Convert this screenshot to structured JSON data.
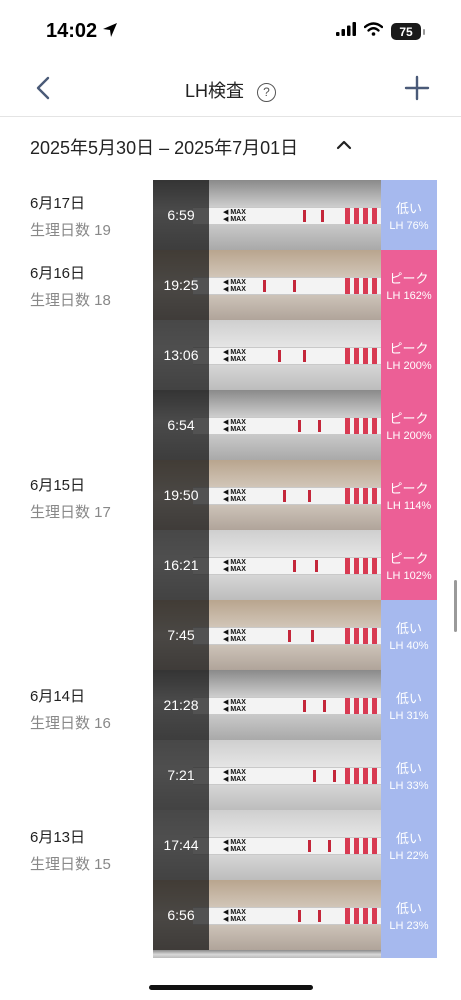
{
  "status_bar": {
    "time": "14:02",
    "battery": "75"
  },
  "nav": {
    "title": "LH検査",
    "help_icon": "?"
  },
  "range": {
    "label": "2025年5月30日 – 2025年7月01日"
  },
  "days": [
    {
      "date": "6月17日",
      "cycle": "生理日数 19"
    },
    {
      "date": "6月16日",
      "cycle": "生理日数 18"
    },
    {
      "date": "6月15日",
      "cycle": "生理日数 17"
    },
    {
      "date": "6月14日",
      "cycle": "生理日数 16"
    },
    {
      "date": "6月13日",
      "cycle": "生理日数 15"
    }
  ],
  "entries": [
    {
      "time": "6:59",
      "status": "低い",
      "lh": "LH 76%",
      "level": "low",
      "lh_percent": 76
    },
    {
      "time": "19:25",
      "status": "ピーク",
      "lh": "LH 162%",
      "level": "peak",
      "lh_percent": 162
    },
    {
      "time": "13:06",
      "status": "ピーク",
      "lh": "LH 200%",
      "level": "peak",
      "lh_percent": 200
    },
    {
      "time": "6:54",
      "status": "ピーク",
      "lh": "LH 200%",
      "level": "peak",
      "lh_percent": 200
    },
    {
      "time": "19:50",
      "status": "ピーク",
      "lh": "LH 114%",
      "level": "peak",
      "lh_percent": 114
    },
    {
      "time": "16:21",
      "status": "ピーク",
      "lh": "LH 102%",
      "level": "peak",
      "lh_percent": 102
    },
    {
      "time": "7:45",
      "status": "低い",
      "lh": "LH 40%",
      "level": "low",
      "lh_percent": 40
    },
    {
      "time": "21:28",
      "status": "低い",
      "lh": "LH 31%",
      "level": "low",
      "lh_percent": 31
    },
    {
      "time": "7:21",
      "status": "低い",
      "lh": "LH 33%",
      "level": "low",
      "lh_percent": 33
    },
    {
      "time": "17:44",
      "status": "低い",
      "lh": "LH 22%",
      "level": "low",
      "lh_percent": 22
    },
    {
      "time": "6:56",
      "status": "低い",
      "lh": "LH 23%",
      "level": "low",
      "lh_percent": 23
    }
  ],
  "colors": {
    "low": "#a6b9ee",
    "peak": "#ec5f96",
    "accent": "#4a5a78"
  }
}
